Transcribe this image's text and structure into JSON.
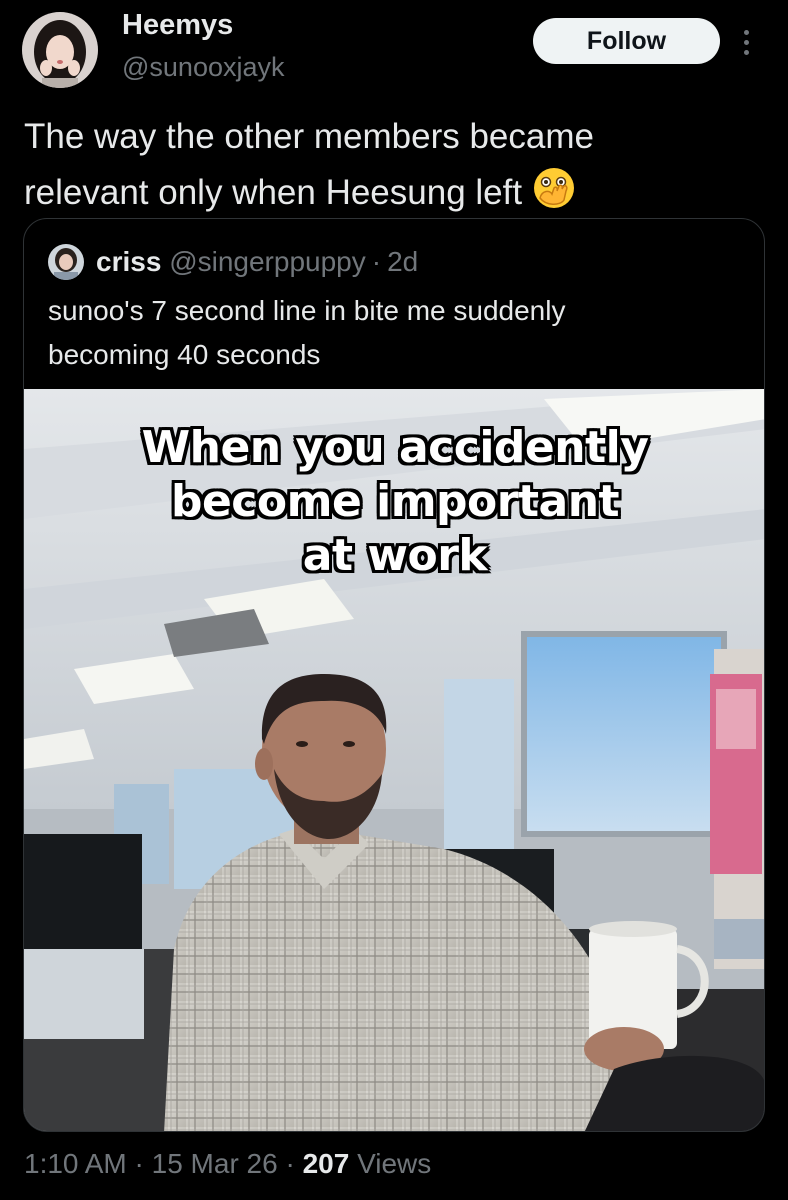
{
  "author": {
    "display_name": "Heemys",
    "handle": "@sunooxjayk",
    "avatar_icon": "profile-photo"
  },
  "follow_button": {
    "label": "Follow"
  },
  "more_button": {
    "icon": "more-options-icon"
  },
  "post": {
    "text_line1": "The way the other members became",
    "text_line2": "relevant only when Heesung left",
    "emoji": "face-with-open-eyes-and-hand-over-mouth-icon"
  },
  "quote": {
    "display_name": "criss",
    "handle": "@singerppuppy",
    "separator": "·",
    "time": "2d",
    "text_line1": "sunoo's 7 second line in bite me suddenly",
    "text_line2": "becoming 40 seconds",
    "media": {
      "caption_line1": "When you accidently",
      "caption_line2": "become important",
      "caption_line3": "at work"
    }
  },
  "footer": {
    "time": "1:10 AM",
    "sep1": "·",
    "date": "15 Mar 26",
    "sep2": "·",
    "views_count": "207",
    "views_label": "Views"
  },
  "colors": {
    "background": "#000000",
    "primary_text": "#e7e9ea",
    "secondary_text": "#71767b",
    "border": "#2f3336",
    "follow_bg": "#eff3f4"
  }
}
